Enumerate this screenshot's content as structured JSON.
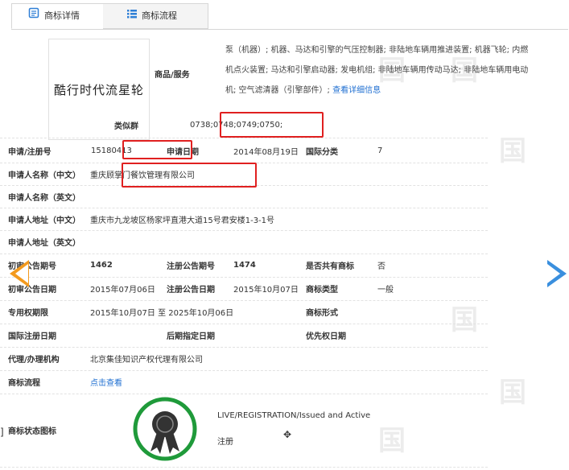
{
  "tabs": [
    {
      "label": "商标详情",
      "icon": "document-icon",
      "active": true
    },
    {
      "label": "商标流程",
      "icon": "list-icon",
      "active": false
    }
  ],
  "watermark": "国",
  "logo_text": "酷行时代流星轮",
  "goods": {
    "label": "商品/服务",
    "text": "泵（机器）; 机器、马达和引擎的气压控制器; 非陆地车辆用推进装置; 机器飞轮; 内燃机点火装置; 马达和引擎启动器; 发电机组; 非陆地车辆用传动马达; 非陆地车辆用电动机; 空气滤清器（引擎部件）;",
    "more_link": "查看详细信息"
  },
  "similar": {
    "label": "类似群",
    "value": "0738;0748;0749;0750;"
  },
  "reg_no": {
    "label": "申请/注册号",
    "value": "15180413"
  },
  "apply_date": {
    "label": "申请日期",
    "value": "2014年08月19日"
  },
  "intl_class": {
    "label": "国际分类",
    "value": "7"
  },
  "applicant_cn": {
    "label": "申请人名称（中文）",
    "value": "重庆顾掌门餐饮管理有限公司"
  },
  "applicant_en": {
    "label": "申请人名称（英文）",
    "value": ""
  },
  "address_cn": {
    "label": "申请人地址（中文）",
    "value": "重庆市九龙坡区杨家坪直港大道15号君安楼1-3-1号"
  },
  "address_en": {
    "label": "申请人地址（英文）",
    "value": ""
  },
  "prelim_no": {
    "label": "初审公告期号",
    "value": "1462"
  },
  "reg_ann_no": {
    "label": "注册公告期号",
    "value": "1474"
  },
  "shared": {
    "label": "是否共有商标",
    "value": "否"
  },
  "prelim_date": {
    "label": "初审公告日期",
    "value": "2015年07月06日"
  },
  "reg_ann_date": {
    "label": "注册公告日期",
    "value": "2015年10月07日"
  },
  "mark_type": {
    "label": "商标类型",
    "value": "一般"
  },
  "exclusive": {
    "label": "专用权期限",
    "value": "2015年10月07日 至 2025年10月06日"
  },
  "mark_form": {
    "label": "商标形式",
    "value": ""
  },
  "intl_reg_date": {
    "label": "国际注册日期",
    "value": ""
  },
  "later_date": {
    "label": "后期指定日期",
    "value": ""
  },
  "priority_date": {
    "label": "优先权日期",
    "value": ""
  },
  "agent": {
    "label": "代理/办理机构",
    "value": "北京集佳知识产权代理有限公司"
  },
  "process": {
    "label": "商标流程",
    "link": "点击查看"
  },
  "status": {
    "label": "商标状态图标",
    "en": "LIVE/REGISTRATION/Issued and Active",
    "cn": "注册"
  },
  "edge_mark": "]",
  "colors": {
    "red_highlight": "#e02020",
    "link": "#1f6fd1",
    "badge_green": "#1f9a3a",
    "arrow_left": "#f39a1e",
    "arrow_right": "#3a8fde"
  }
}
